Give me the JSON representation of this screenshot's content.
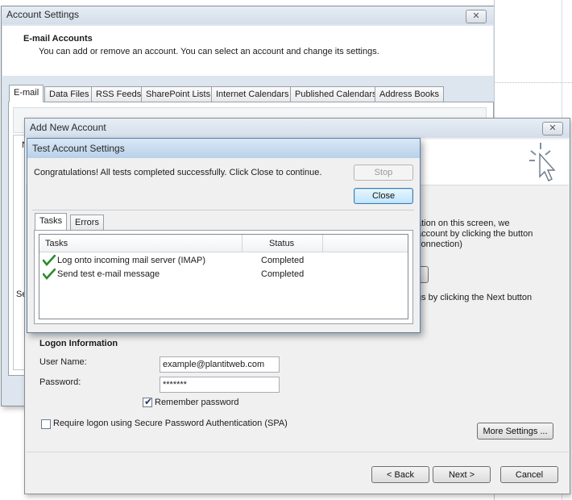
{
  "account_settings": {
    "title": "Account Settings",
    "close_label": "✕",
    "header_title": "E-mail Accounts",
    "header_desc": "You can add or remove an account. You can select an account and change its settings.",
    "tabs": [
      "E-mail",
      "Data Files",
      "RSS Feeds",
      "SharePoint Lists",
      "Internet Calendars",
      "Published Calendars",
      "Address Books"
    ],
    "fragment_n": "N",
    "fragment_se": "Se"
  },
  "add_account": {
    "title": "Add New Account",
    "close_label": "✕",
    "right_text": [
      "ation on this screen, we",
      "account by clicking the button",
      "connection)",
      "gs by clicking the Next button"
    ],
    "logon_title": "Logon Information",
    "user_name_label": "User Name:",
    "user_name_value": "example@plantitweb.com",
    "password_label": "Password:",
    "password_value": "*******",
    "remember_label": "Remember password",
    "remember_checked": true,
    "spa_label": "Require logon using Secure Password Authentication (SPA)",
    "spa_checked": false,
    "more_settings_label": "More Settings ...",
    "back_label": "< Back",
    "next_label": "Next >",
    "cancel_label": "Cancel"
  },
  "test_settings": {
    "title": "Test Account Settings",
    "message": "Congratulations! All tests completed successfully. Click Close to continue.",
    "stop_label": "Stop",
    "close_label": "Close",
    "tabs": [
      "Tasks",
      "Errors"
    ],
    "columns": [
      "Tasks",
      "Status"
    ],
    "rows": [
      {
        "task": "Log onto incoming mail server (IMAP)",
        "status": "Completed"
      },
      {
        "task": "Send test e-mail message",
        "status": "Completed"
      }
    ]
  },
  "colors": {
    "title_active": "#c9dcef",
    "title_inactive": "#dde6ef",
    "check_green": "#2c8a2c"
  }
}
